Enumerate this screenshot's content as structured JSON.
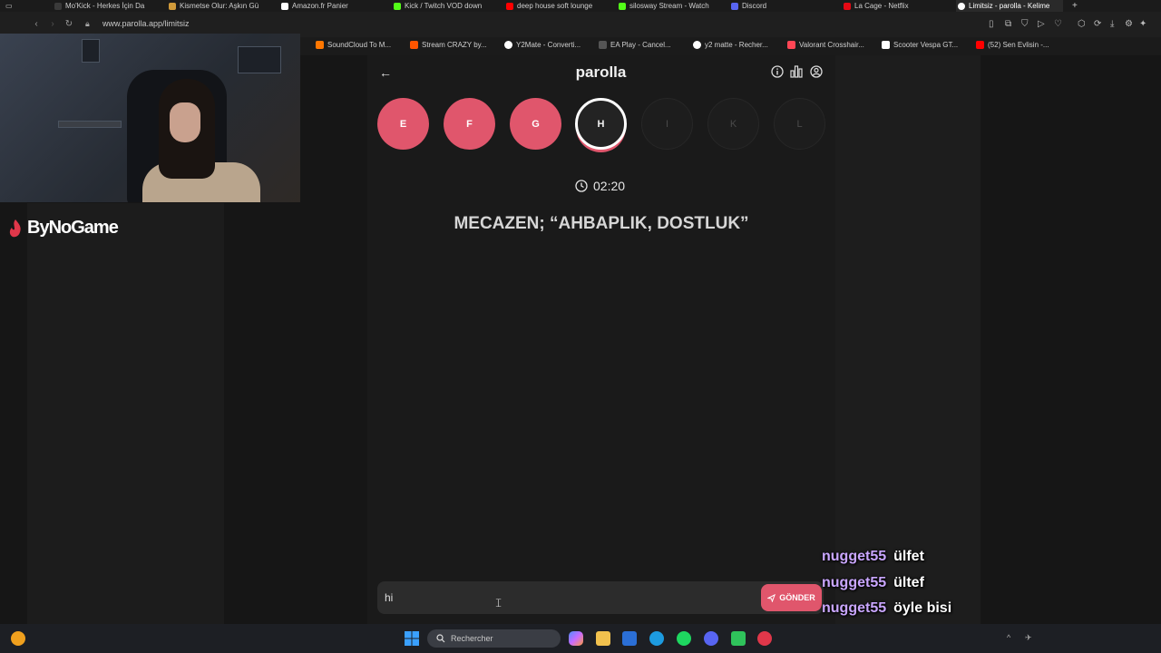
{
  "tabs": [
    {
      "label": "Mo'Kick - Herkes İçin Da",
      "color": "#3a3a3a"
    },
    {
      "label": "Kismetse Olur: Aşkın Gü",
      "color": "#d09a3a"
    },
    {
      "label": "Amazon.fr Panier",
      "color": "#ffffff"
    },
    {
      "label": "Kick / Twitch VOD down",
      "color": "#53fc18"
    },
    {
      "label": "deep house soft lounge",
      "color": "#ff0000"
    },
    {
      "label": "silosway Stream - Watch",
      "color": "#53fc18"
    },
    {
      "label": "Discord",
      "color": "#5865f2"
    },
    {
      "label": "La Cage - Netflix",
      "color": "#e50914"
    },
    {
      "label": "Limitsiz - parolla - Kelime",
      "color": "#ffffff",
      "active": true
    }
  ],
  "address_bar": {
    "url": "www.parolla.app/limitsiz"
  },
  "bookmarks": [
    {
      "label": "SoundCloud To M...",
      "color": "#ff7700"
    },
    {
      "label": "Stream CRAZY by...",
      "color": "#ff5500"
    },
    {
      "label": "Y2Mate - Converti...",
      "color": "#ffffff"
    },
    {
      "label": "EA Play - Cancel...",
      "color": "#222222"
    },
    {
      "label": "y2 matte - Recher...",
      "color": "#ffffff"
    },
    {
      "label": "Valorant Crosshair...",
      "color": "#ff4655"
    },
    {
      "label": "Scooter Vespa GT...",
      "color": "#ffffff"
    },
    {
      "label": "(52) Sen Evlisin -...",
      "color": "#ff0000"
    }
  ],
  "overlay": {
    "brand": "ByNoGame"
  },
  "app": {
    "title": "parolla",
    "icons": [
      "info-icon",
      "stats-icon",
      "profile-icon"
    ],
    "letters": [
      {
        "letter": "E",
        "state": "done"
      },
      {
        "letter": "F",
        "state": "done"
      },
      {
        "letter": "G",
        "state": "done"
      },
      {
        "letter": "H",
        "state": "current"
      },
      {
        "letter": "I",
        "state": "pending"
      },
      {
        "letter": "K",
        "state": "pending"
      },
      {
        "letter": "L",
        "state": "pending"
      }
    ],
    "timer": "02:20",
    "question": "MECAZEN; “AHBAPLIK, DOSTLUK”",
    "answer_value": "hi",
    "send_label": "GÖNDER"
  },
  "chat": [
    {
      "user": "nugget55",
      "message": "ülfet"
    },
    {
      "user": "nugget55",
      "message": "ültef"
    },
    {
      "user": "nugget55",
      "message": "öyle bisi"
    }
  ],
  "taskbar": {
    "search_placeholder": "Rechercher"
  }
}
